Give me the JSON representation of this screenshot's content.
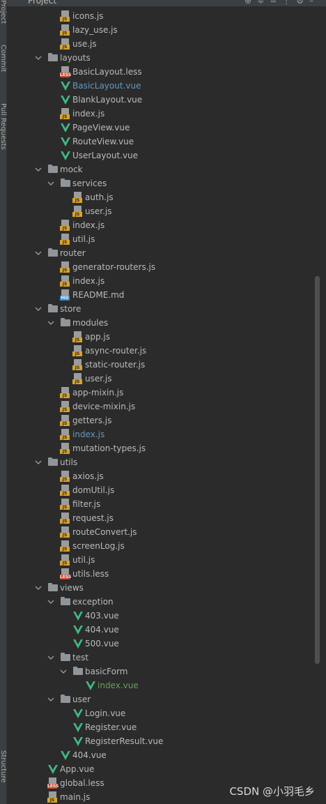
{
  "app": {
    "panel_title": "Project",
    "side_tabs": [
      "Project",
      "Commit",
      "Pull Requests",
      "Structure"
    ]
  },
  "colors": {
    "background": "#2b2b2b",
    "text": "#bbbbbb",
    "modified_blue": "#6897bb",
    "added_green": "#62a455",
    "vue_green": "#41b883",
    "js_tag": "#d8a32c",
    "less_tag": "#c8452d"
  },
  "tree": [
    {
      "level": 3,
      "type": "js",
      "name": "icons.js"
    },
    {
      "level": 3,
      "type": "js",
      "name": "lazy_use.js"
    },
    {
      "level": 3,
      "type": "js",
      "name": "use.js"
    },
    {
      "level": 2,
      "type": "folder",
      "name": "layouts",
      "expanded": true
    },
    {
      "level": 3,
      "type": "less",
      "name": "BasicLayout.less"
    },
    {
      "level": 3,
      "type": "vue",
      "name": "BasicLayout.vue",
      "status": "modified"
    },
    {
      "level": 3,
      "type": "vue",
      "name": "BlankLayout.vue"
    },
    {
      "level": 3,
      "type": "js",
      "name": "index.js"
    },
    {
      "level": 3,
      "type": "vue",
      "name": "PageView.vue"
    },
    {
      "level": 3,
      "type": "vue",
      "name": "RouteView.vue"
    },
    {
      "level": 3,
      "type": "vue",
      "name": "UserLayout.vue"
    },
    {
      "level": 2,
      "type": "folder",
      "name": "mock",
      "expanded": true
    },
    {
      "level": 3,
      "type": "folder",
      "name": "services",
      "expanded": true
    },
    {
      "level": 4,
      "type": "js",
      "name": "auth.js"
    },
    {
      "level": 4,
      "type": "js",
      "name": "user.js"
    },
    {
      "level": 3,
      "type": "js",
      "name": "index.js"
    },
    {
      "level": 3,
      "type": "js",
      "name": "util.js"
    },
    {
      "level": 2,
      "type": "folder",
      "name": "router",
      "expanded": true
    },
    {
      "level": 3,
      "type": "js",
      "name": "generator-routers.js"
    },
    {
      "level": 3,
      "type": "js",
      "name": "index.js"
    },
    {
      "level": 3,
      "type": "md",
      "name": "README.md"
    },
    {
      "level": 2,
      "type": "folder",
      "name": "store",
      "expanded": true
    },
    {
      "level": 3,
      "type": "folder",
      "name": "modules",
      "expanded": true
    },
    {
      "level": 4,
      "type": "js",
      "name": "app.js"
    },
    {
      "level": 4,
      "type": "js",
      "name": "async-router.js"
    },
    {
      "level": 4,
      "type": "js",
      "name": "static-router.js"
    },
    {
      "level": 4,
      "type": "js",
      "name": "user.js"
    },
    {
      "level": 3,
      "type": "js",
      "name": "app-mixin.js"
    },
    {
      "level": 3,
      "type": "js",
      "name": "device-mixin.js"
    },
    {
      "level": 3,
      "type": "js",
      "name": "getters.js"
    },
    {
      "level": 3,
      "type": "js",
      "name": "index.js",
      "status": "modified"
    },
    {
      "level": 3,
      "type": "js",
      "name": "mutation-types.js"
    },
    {
      "level": 2,
      "type": "folder",
      "name": "utils",
      "expanded": true
    },
    {
      "level": 3,
      "type": "js",
      "name": "axios.js"
    },
    {
      "level": 3,
      "type": "js",
      "name": "domUtil.js"
    },
    {
      "level": 3,
      "type": "js",
      "name": "filter.js"
    },
    {
      "level": 3,
      "type": "js",
      "name": "request.js"
    },
    {
      "level": 3,
      "type": "js",
      "name": "routeConvert.js"
    },
    {
      "level": 3,
      "type": "js",
      "name": "screenLog.js"
    },
    {
      "level": 3,
      "type": "js",
      "name": "util.js"
    },
    {
      "level": 3,
      "type": "less",
      "name": "utils.less"
    },
    {
      "level": 2,
      "type": "folder",
      "name": "views",
      "expanded": true
    },
    {
      "level": 3,
      "type": "folder",
      "name": "exception",
      "expanded": true
    },
    {
      "level": 4,
      "type": "vue",
      "name": "403.vue"
    },
    {
      "level": 4,
      "type": "vue",
      "name": "404.vue"
    },
    {
      "level": 4,
      "type": "vue",
      "name": "500.vue"
    },
    {
      "level": 3,
      "type": "folder",
      "name": "test",
      "expanded": true
    },
    {
      "level": 4,
      "type": "folder",
      "name": "basicForm",
      "expanded": true
    },
    {
      "level": 5,
      "type": "vue",
      "name": "index.vue",
      "status": "added"
    },
    {
      "level": 3,
      "type": "folder",
      "name": "user",
      "expanded": true
    },
    {
      "level": 4,
      "type": "vue",
      "name": "Login.vue"
    },
    {
      "level": 4,
      "type": "vue",
      "name": "Register.vue"
    },
    {
      "level": 4,
      "type": "vue",
      "name": "RegisterResult.vue"
    },
    {
      "level": 3,
      "type": "vue",
      "name": "404.vue"
    },
    {
      "level": 2,
      "type": "vue",
      "name": "App.vue"
    },
    {
      "level": 2,
      "type": "less",
      "name": "global.less"
    },
    {
      "level": 2,
      "type": "js",
      "name": "main.js"
    }
  ],
  "watermark": "CSDN @小羽毛乡"
}
